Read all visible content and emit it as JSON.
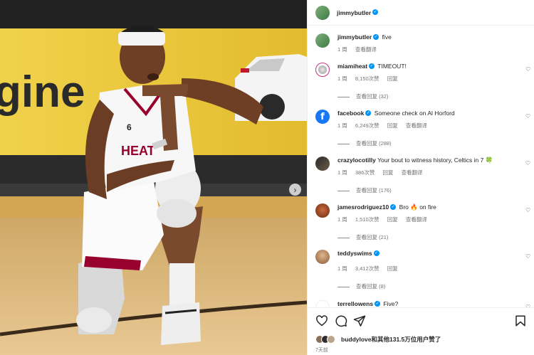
{
  "post": {
    "author": "jimmybutler",
    "caption": "five",
    "caption_time": "1 周",
    "caption_translate": "查看翻译",
    "image_description_icon": "next-image-chevron"
  },
  "comments": [
    {
      "user": "miamiheat",
      "verified": true,
      "text": "TIMEOUT!",
      "time": "1 周",
      "likes": "8,150次赞",
      "reply": "回复",
      "translate": "",
      "view_replies": "查看回复 (32)"
    },
    {
      "user": "facebook",
      "verified": true,
      "text": "Someone check on Al Horford",
      "time": "1 周",
      "likes": "6,249次赞",
      "reply": "回复",
      "translate": "查看翻译",
      "view_replies": "查看回复 (288)"
    },
    {
      "user": "crazylocotilly",
      "verified": false,
      "text": "Your bout to witness history, Celtics in 7 🍀",
      "time": "1 周",
      "likes": "386次赞",
      "reply": "回复",
      "translate": "查看翻译",
      "view_replies": "查看回复 (176)"
    },
    {
      "user": "jamesrodriguez10",
      "verified": true,
      "text": "Bro 🔥 on fire",
      "time": "1 周",
      "likes": "1,510次赞",
      "reply": "回复",
      "translate": "查看翻译",
      "view_replies": "查看回复 (21)"
    },
    {
      "user": "teddyswims",
      "verified": true,
      "text": "",
      "time": "1 周",
      "likes": "3,412次赞",
      "reply": "回复",
      "translate": "",
      "view_replies": "查看回复 (8)"
    },
    {
      "user": "terrellowens",
      "verified": true,
      "text": "Five?",
      "time": "",
      "likes": "",
      "reply": "",
      "translate": "",
      "view_replies": ""
    }
  ],
  "footer": {
    "liked_by": "buddylove和其他131.5万位用户赞了",
    "posted": "7天前"
  },
  "colors": {
    "verified": "#0095f6",
    "secondary_text": "#737373",
    "court_yellow": "#e9c23a",
    "jersey_red": "#98002e"
  }
}
